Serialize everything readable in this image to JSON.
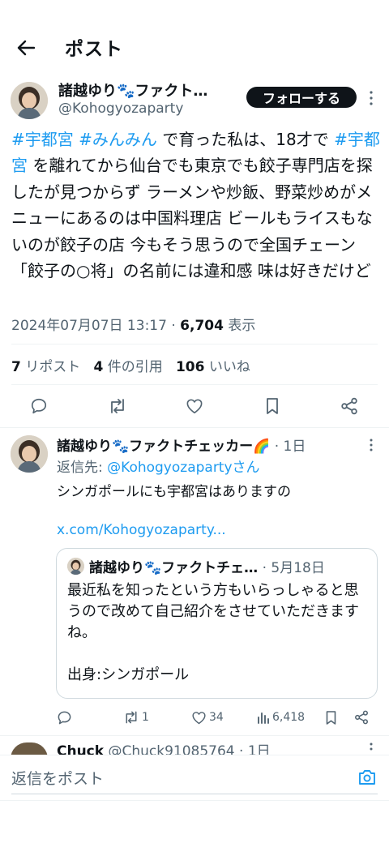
{
  "header": {
    "title": "ポスト"
  },
  "main_post": {
    "author_name": "諸越ゆり🐾ファクト…",
    "handle": "@Kohogyozaparty",
    "follow_label": "フォローする",
    "text_parts": [
      {
        "t": "#宇都宮",
        "tag": true
      },
      {
        "t": " ",
        "tag": false
      },
      {
        "t": "#みんみん",
        "tag": true
      },
      {
        "t": " で育った私は、18才で ",
        "tag": false
      },
      {
        "t": "#宇都宮",
        "tag": true
      },
      {
        "t": " を離れてから仙台でも東京でも餃子専門店を探したが見つからず ラーメンや炒飯、野菜炒めがメニューにあるのは中国料理店 ビールもライスもないのが餃子の店 今もそう思うので全国チェーン「餃子の○将」の名前には違和感 味は好きだけど",
        "tag": false
      }
    ],
    "timestamp": "2024年07月07日 13:17",
    "views_count": "6,704",
    "views_label": "表示",
    "reposts_count": "7",
    "reposts_label": "リポスト",
    "quotes_count": "4",
    "quotes_label": "件の引用",
    "likes_count": "106",
    "likes_label": "いいね"
  },
  "reply": {
    "author_name": "諸越ゆり🐾ファクトチェッカー🌈",
    "time": "· 1日",
    "reply_to_label": "返信先: ",
    "reply_to_handle": "@Kohogyozapartyさん",
    "text": "シンガポールにも宇都宮はありますの",
    "link": "x.com/Kohogyozaparty...",
    "quote": {
      "author_name": "諸越ゆり🐾ファクトチェ…",
      "time": "· 5月18日",
      "text_line1": "最近私を知ったという方もいらっしゃると思うので改めて自己紹介をさせていただきますね。",
      "text_line2": "出身:シンガポール"
    },
    "reposts": "1",
    "likes": "34",
    "views": "6,418"
  },
  "next_reply": {
    "author_name": "Chuck",
    "handle_time": "@Chuck91085764 · 1日"
  },
  "reply_bar": {
    "placeholder": "返信をポスト"
  },
  "colors": {
    "accent": "#1d9bf0",
    "text": "#0f1419",
    "secondary": "#536471"
  }
}
